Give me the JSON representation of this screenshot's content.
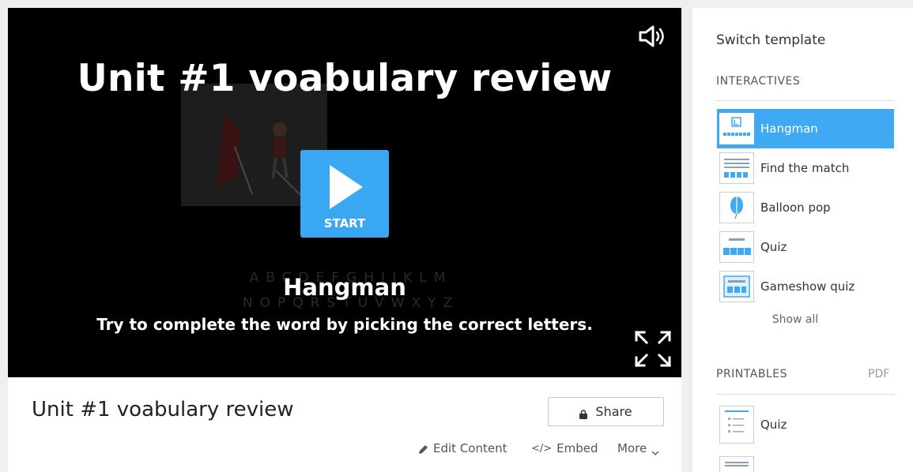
{
  "game": {
    "title": "Unit #1 voabulary review",
    "start_label": "START",
    "letters_row1": "ABCDEFGHIJKLM",
    "letters_row2": "NOPQRSTUVWXYZ",
    "template_name": "Hangman",
    "description": "Try to complete the word by picking the correct letters."
  },
  "info": {
    "title": "Unit #1 voabulary review",
    "share_label": "Share",
    "edit_label": "Edit Content",
    "embed_label": "Embed",
    "more_label": "More"
  },
  "sidebar": {
    "switch_title": "Switch template",
    "interactives_header": "INTERACTIVES",
    "templates": [
      {
        "label": "Hangman",
        "icon": "hangman-icon",
        "active": true
      },
      {
        "label": "Find the match",
        "icon": "find-the-match-icon",
        "active": false
      },
      {
        "label": "Balloon pop",
        "icon": "balloon-icon",
        "active": false
      },
      {
        "label": "Quiz",
        "icon": "quiz-icon",
        "active": false
      },
      {
        "label": "Gameshow quiz",
        "icon": "gameshow-icon",
        "active": false
      }
    ],
    "show_all": "Show all",
    "printables_header": "PRINTABLES",
    "pdf_label": "PDF",
    "printables": [
      {
        "label": "Quiz",
        "icon": "quiz-printable-icon"
      }
    ]
  },
  "colors": {
    "accent": "#40a9f4",
    "start_button": "#3aa7f3"
  }
}
